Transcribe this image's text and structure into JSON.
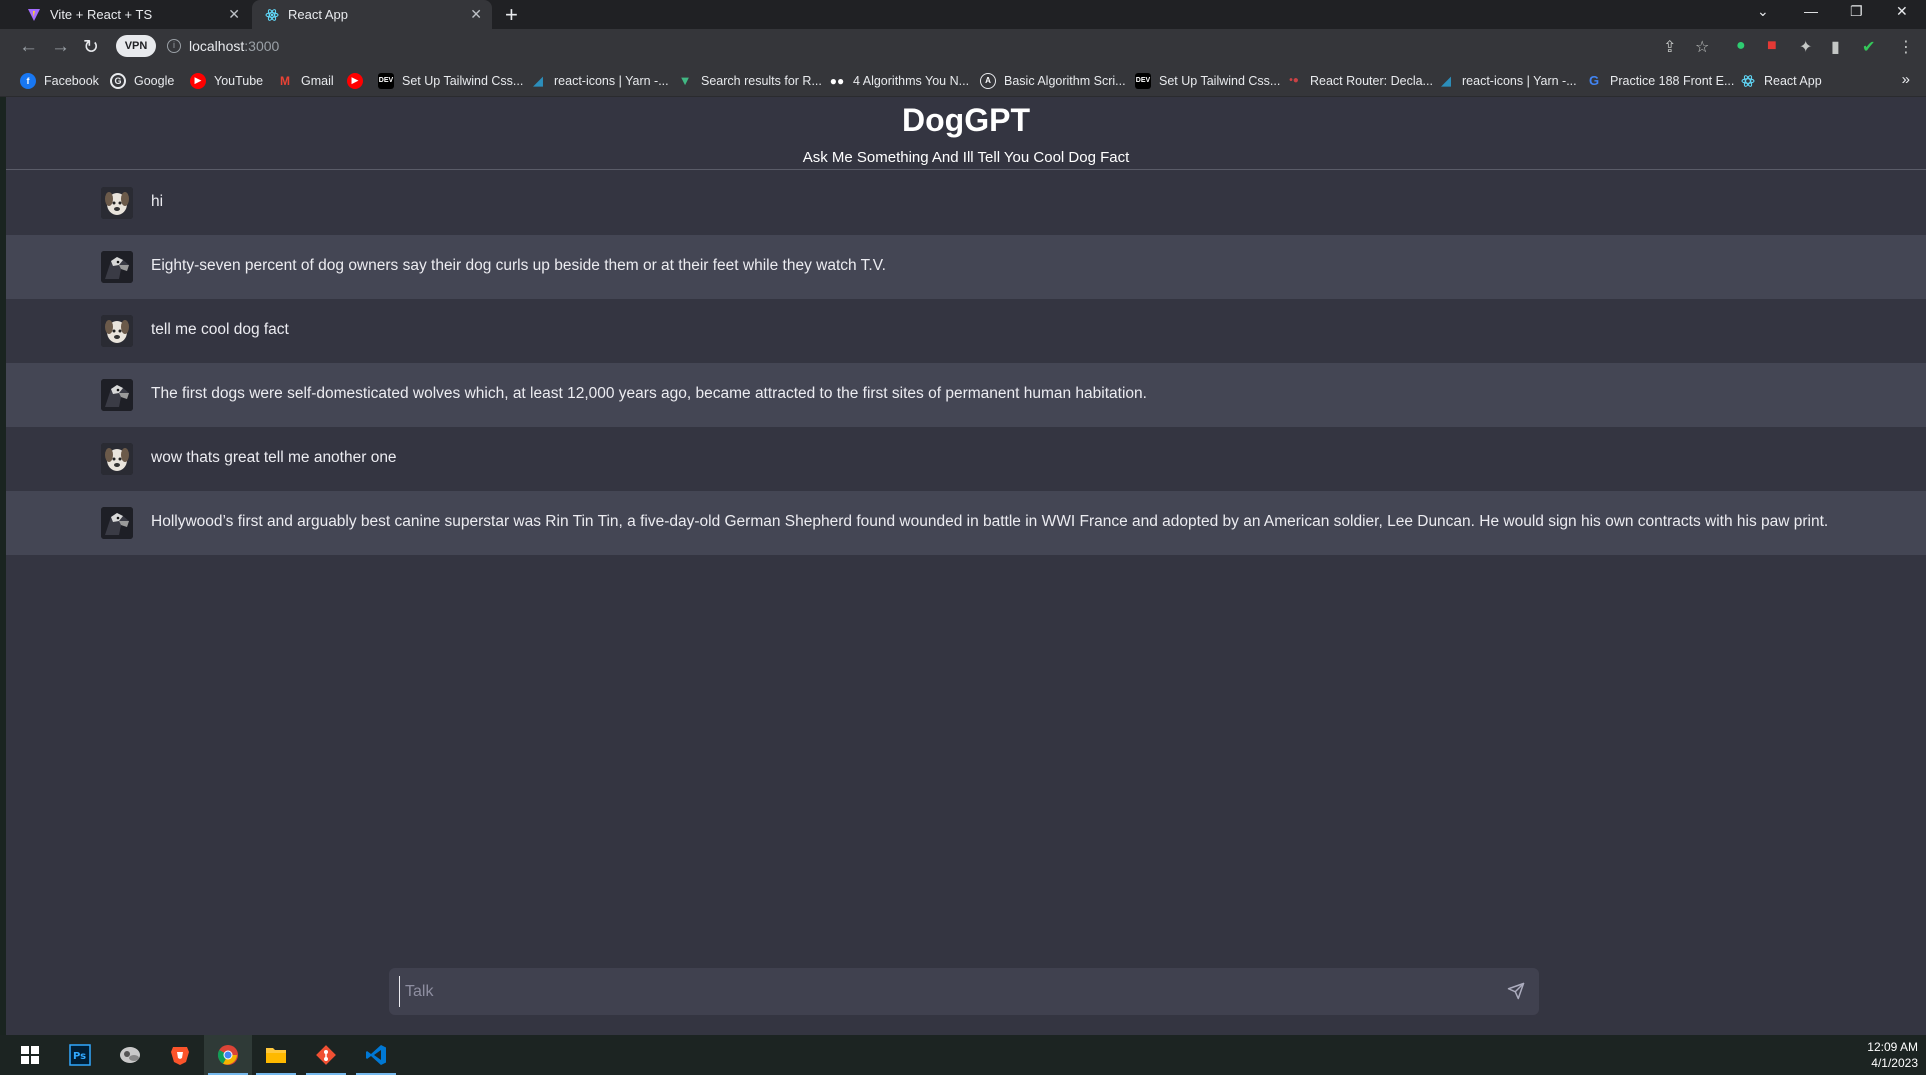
{
  "browser": {
    "tabs": [
      {
        "title": "Vite + React + TS",
        "favicon": "vite-icon",
        "active": false
      },
      {
        "title": "React App",
        "favicon": "react-icon",
        "active": true
      }
    ],
    "address": {
      "vpn_label": "VPN",
      "host": "localhost",
      "port": ":3000"
    },
    "bookmarks": [
      {
        "label": "Facebook",
        "icon": "facebook-icon",
        "color": "#1877f2"
      },
      {
        "label": "Google",
        "icon": "google-icon",
        "color": "#e8eaed"
      },
      {
        "label": "YouTube",
        "icon": "youtube-icon",
        "color": "#ff0000"
      },
      {
        "label": "Gmail",
        "icon": "gmail-icon",
        "color": "#ea4335"
      },
      {
        "label": "",
        "icon": "youtube-icon",
        "color": "#ff0000"
      },
      {
        "label": "Set Up Tailwind Css...",
        "icon": "dev-icon",
        "color": "#000000"
      },
      {
        "label": "react-icons | Yarn -...",
        "icon": "yarn-icon",
        "color": "#2c8ebb"
      },
      {
        "label": "Search results for R...",
        "icon": "vue-icon",
        "color": "#41b883"
      },
      {
        "label": "4 Algorithms You N...",
        "icon": "medium-icon",
        "color": "#000000"
      },
      {
        "label": "Basic Algorithm Scri...",
        "icon": "freecodecamp-icon",
        "color": "#0a0a23"
      },
      {
        "label": "Set Up Tailwind Css...",
        "icon": "dev-icon",
        "color": "#000000"
      },
      {
        "label": "React Router: Decla...",
        "icon": "react-router-icon",
        "color": "#ca4245"
      },
      {
        "label": "react-icons | Yarn -...",
        "icon": "yarn-icon",
        "color": "#2c8ebb"
      },
      {
        "label": "Practice 188 Front E...",
        "icon": "greatfrontend-icon",
        "color": "#4285f4"
      },
      {
        "label": "React App",
        "icon": "react-icon",
        "color": "#61dafb"
      }
    ]
  },
  "app": {
    "title": "DogGPT",
    "subtitle": "Ask Me Something And Ill Tell You Cool Dog Fact",
    "messages": [
      {
        "role": "user",
        "text": "hi"
      },
      {
        "role": "bot",
        "text": "Eighty-seven percent of dog owners say their dog curls up beside them or at their feet while they watch T.V."
      },
      {
        "role": "user",
        "text": "tell me cool dog fact"
      },
      {
        "role": "bot",
        "text": "The first dogs were self-domesticated wolves which, at least 12,000 years ago, became attracted to the first sites of permanent human habitation."
      },
      {
        "role": "user",
        "text": "wow thats great tell me another one"
      },
      {
        "role": "bot",
        "text": "Hollywood’s first and arguably best canine superstar was Rin Tin Tin, a five-day-old German Shepherd found wounded in battle in WWI France and adopted by an American soldier, Lee Duncan. He would sign his own contracts with his paw print."
      }
    ],
    "input": {
      "placeholder": "Talk",
      "value": ""
    }
  },
  "taskbar": {
    "apps": [
      "windows-start-icon",
      "photoshop-icon",
      "app-icon",
      "brave-icon",
      "chrome-icon",
      "file-explorer-icon",
      "git-icon",
      "vscode-icon"
    ],
    "time": "12:09 AM",
    "date": "4/1/2023"
  }
}
